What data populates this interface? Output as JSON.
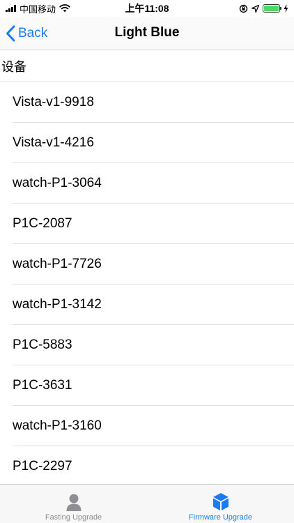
{
  "status_bar": {
    "carrier": "中国移动",
    "time": "上午11:08"
  },
  "nav": {
    "back_label": "Back",
    "title": "Light Blue"
  },
  "section": {
    "header": "设备"
  },
  "devices": [
    "Vista-v1-9918",
    "Vista-v1-4216",
    "watch-P1-3064",
    "P1C-2087",
    "watch-P1-7726",
    "watch-P1-3142",
    "P1C-5883",
    "P1C-3631",
    "watch-P1-3160",
    "P1C-2297"
  ],
  "tabs": [
    {
      "label": "Fasting Upgrade",
      "icon": "person-icon",
      "active": false
    },
    {
      "label": "Firmware Upgrade",
      "icon": "cube-icon",
      "active": true
    }
  ],
  "colors": {
    "accent": "#1a7cf5",
    "inactive": "#8e8e93",
    "battery": "#4cd964"
  }
}
